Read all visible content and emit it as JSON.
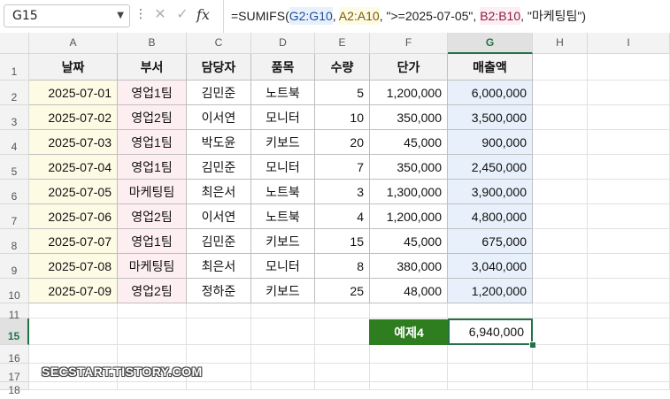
{
  "formula_bar": {
    "name_box": "G15",
    "formula_segments": [
      {
        "text": "=SUMIFS(",
        "color": "#222222",
        "bg": ""
      },
      {
        "text": "G2:G10",
        "color": "#1f4e9e",
        "bg": "#e8f1fb"
      },
      {
        "text": ", ",
        "color": "#222222",
        "bg": ""
      },
      {
        "text": "A2:A10",
        "color": "#7a5b00",
        "bg": "#fefbe5"
      },
      {
        "text": ", \">=2025-07-05\", ",
        "color": "#222222",
        "bg": ""
      },
      {
        "text": "B2:B10",
        "color": "#8b1e4a",
        "bg": "#fdeef2"
      },
      {
        "text": ", \"마케팅팀\")",
        "color": "#222222",
        "bg": ""
      }
    ]
  },
  "columns": [
    "A",
    "B",
    "C",
    "D",
    "E",
    "F",
    "G",
    "H",
    "I"
  ],
  "rows": [
    "1",
    "2",
    "3",
    "4",
    "5",
    "6",
    "7",
    "8",
    "9",
    "10",
    "11",
    "15",
    "16",
    "17",
    "18"
  ],
  "selected": {
    "column": "G",
    "row": "15"
  },
  "table": {
    "headers": [
      "날짜",
      "부서",
      "담당자",
      "품목",
      "수량",
      "단가",
      "매출액"
    ],
    "rows": [
      [
        "2025-07-01",
        "영업1팀",
        "김민준",
        "노트북",
        "5",
        "1,200,000",
        "6,000,000"
      ],
      [
        "2025-07-02",
        "영업2팀",
        "이서연",
        "모니터",
        "10",
        "350,000",
        "3,500,000"
      ],
      [
        "2025-07-03",
        "영업1팀",
        "박도윤",
        "키보드",
        "20",
        "45,000",
        "900,000"
      ],
      [
        "2025-07-04",
        "영업1팀",
        "김민준",
        "모니터",
        "7",
        "350,000",
        "2,450,000"
      ],
      [
        "2025-07-05",
        "마케팅팀",
        "최은서",
        "노트북",
        "3",
        "1,300,000",
        "3,900,000"
      ],
      [
        "2025-07-06",
        "영업2팀",
        "이서연",
        "노트북",
        "4",
        "1,200,000",
        "4,800,000"
      ],
      [
        "2025-07-07",
        "영업1팀",
        "김민준",
        "키보드",
        "15",
        "45,000",
        "675,000"
      ],
      [
        "2025-07-08",
        "마케팅팀",
        "최은서",
        "모니터",
        "8",
        "380,000",
        "3,040,000"
      ],
      [
        "2025-07-09",
        "영업2팀",
        "정하준",
        "키보드",
        "25",
        "48,000",
        "1,200,000"
      ]
    ]
  },
  "example": {
    "label": "예제4",
    "value": "6,940,000"
  },
  "watermark": "SECSTART.TISTORY.COM",
  "colors": {
    "accent": "#217346",
    "label_bg": "#2e7d1e"
  }
}
